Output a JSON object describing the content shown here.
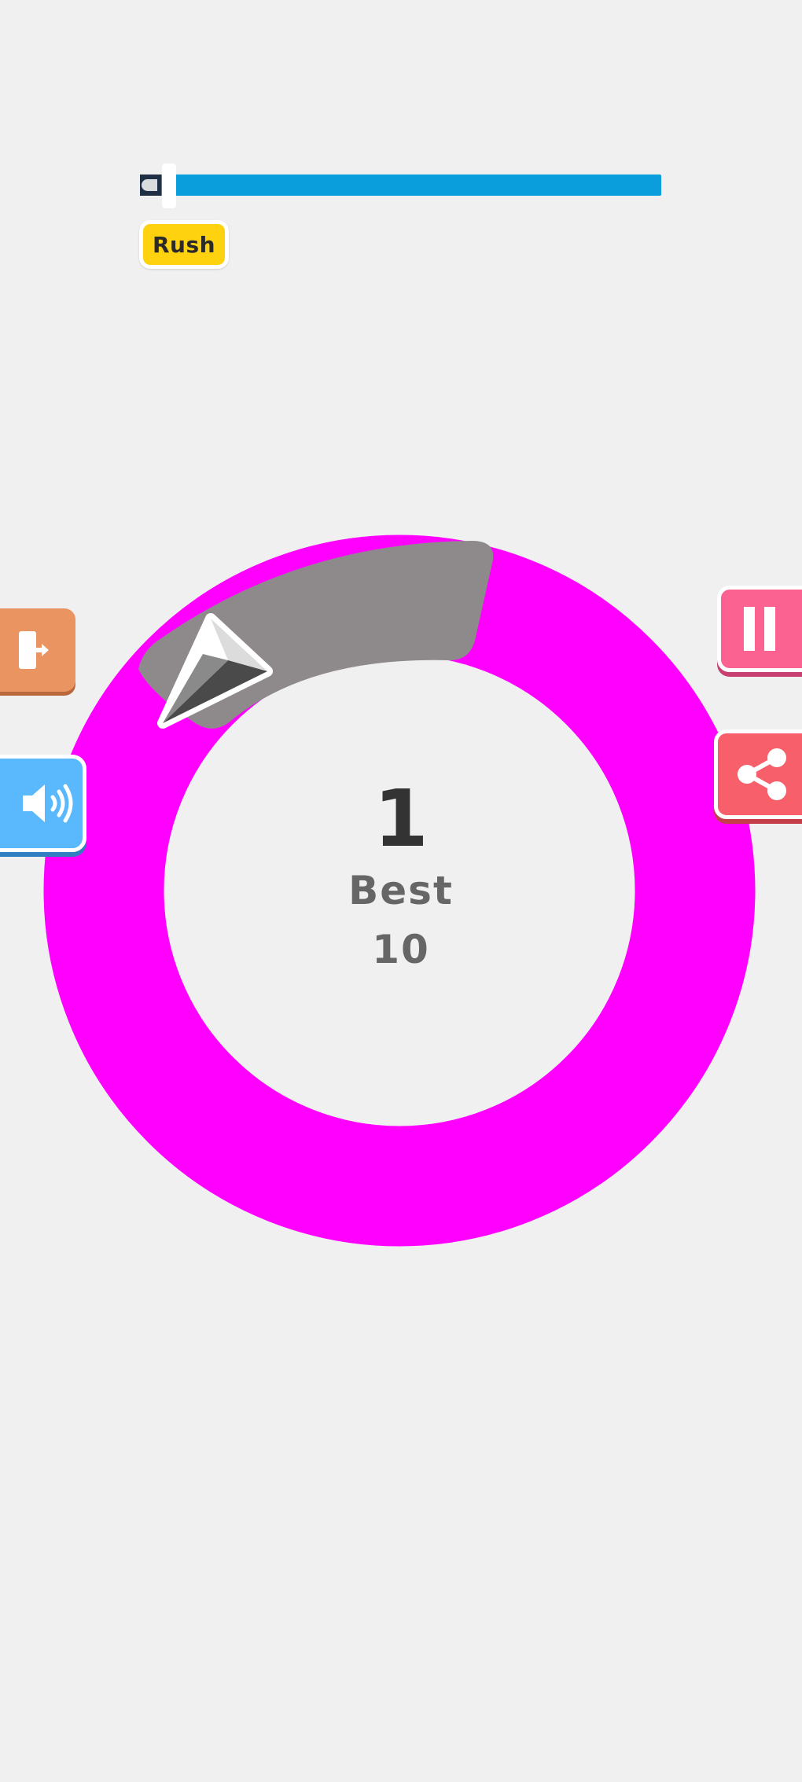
{
  "progress": {
    "value_fraction": 0.04,
    "bar_color": "#0a9fdc"
  },
  "mode_badge": {
    "label": "Rush",
    "color": "#ffd210"
  },
  "ring": {
    "color": "#ff00ff",
    "obstacle_color": "#8e8a8c"
  },
  "player": {
    "icon": "paper-plane-icon"
  },
  "score": {
    "current": "1",
    "best_label": "Best",
    "best_value": "10"
  },
  "buttons": {
    "exit": {
      "icon": "exit-door-icon",
      "color": "#ea9462"
    },
    "sound": {
      "icon": "speaker-icon",
      "color": "#5ab8fc"
    },
    "pause": {
      "icon": "pause-icon",
      "color": "#fb6292"
    },
    "share": {
      "icon": "share-icon",
      "color": "#f75f6b"
    }
  }
}
